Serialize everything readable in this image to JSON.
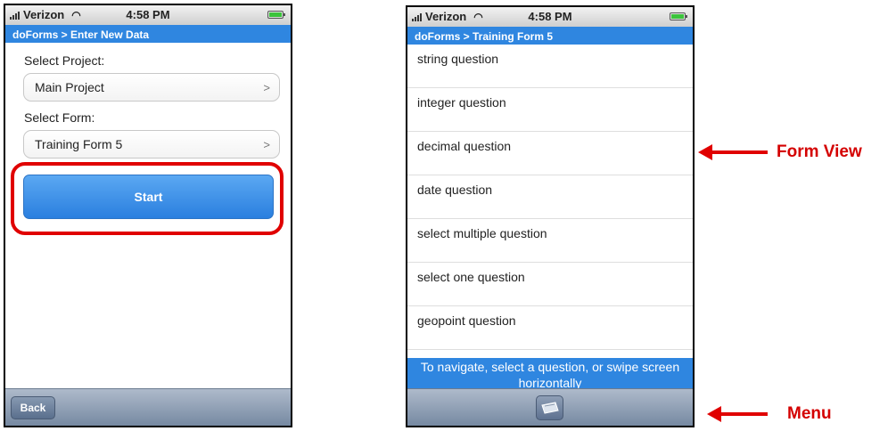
{
  "left_screen": {
    "status": {
      "carrier": "Verizon",
      "time": "4:58 PM"
    },
    "breadcrumb": "doForms > Enter New Data",
    "project_label": "Select Project:",
    "project_value": "Main Project",
    "form_label": "Select Form:",
    "form_value": "Training Form 5",
    "chevron": ">",
    "start_label": "Start",
    "back_label": "Back"
  },
  "right_screen": {
    "status": {
      "carrier": "Verizon",
      "time": "4:58 PM"
    },
    "breadcrumb": "doForms > Training Form 5",
    "questions": [
      "string question",
      "integer question",
      "decimal question",
      "date question",
      "select multiple question",
      "select one question",
      "geopoint question"
    ],
    "hint": "To navigate, select a question, or swipe screen horizontally",
    "menu_icon": "menu-icon"
  },
  "callouts": {
    "form_view": "Form View",
    "menu": "Menu"
  },
  "colors": {
    "title_bar": "#2f86e0",
    "highlight_ring": "#e00000",
    "callout_text": "#d40000"
  }
}
